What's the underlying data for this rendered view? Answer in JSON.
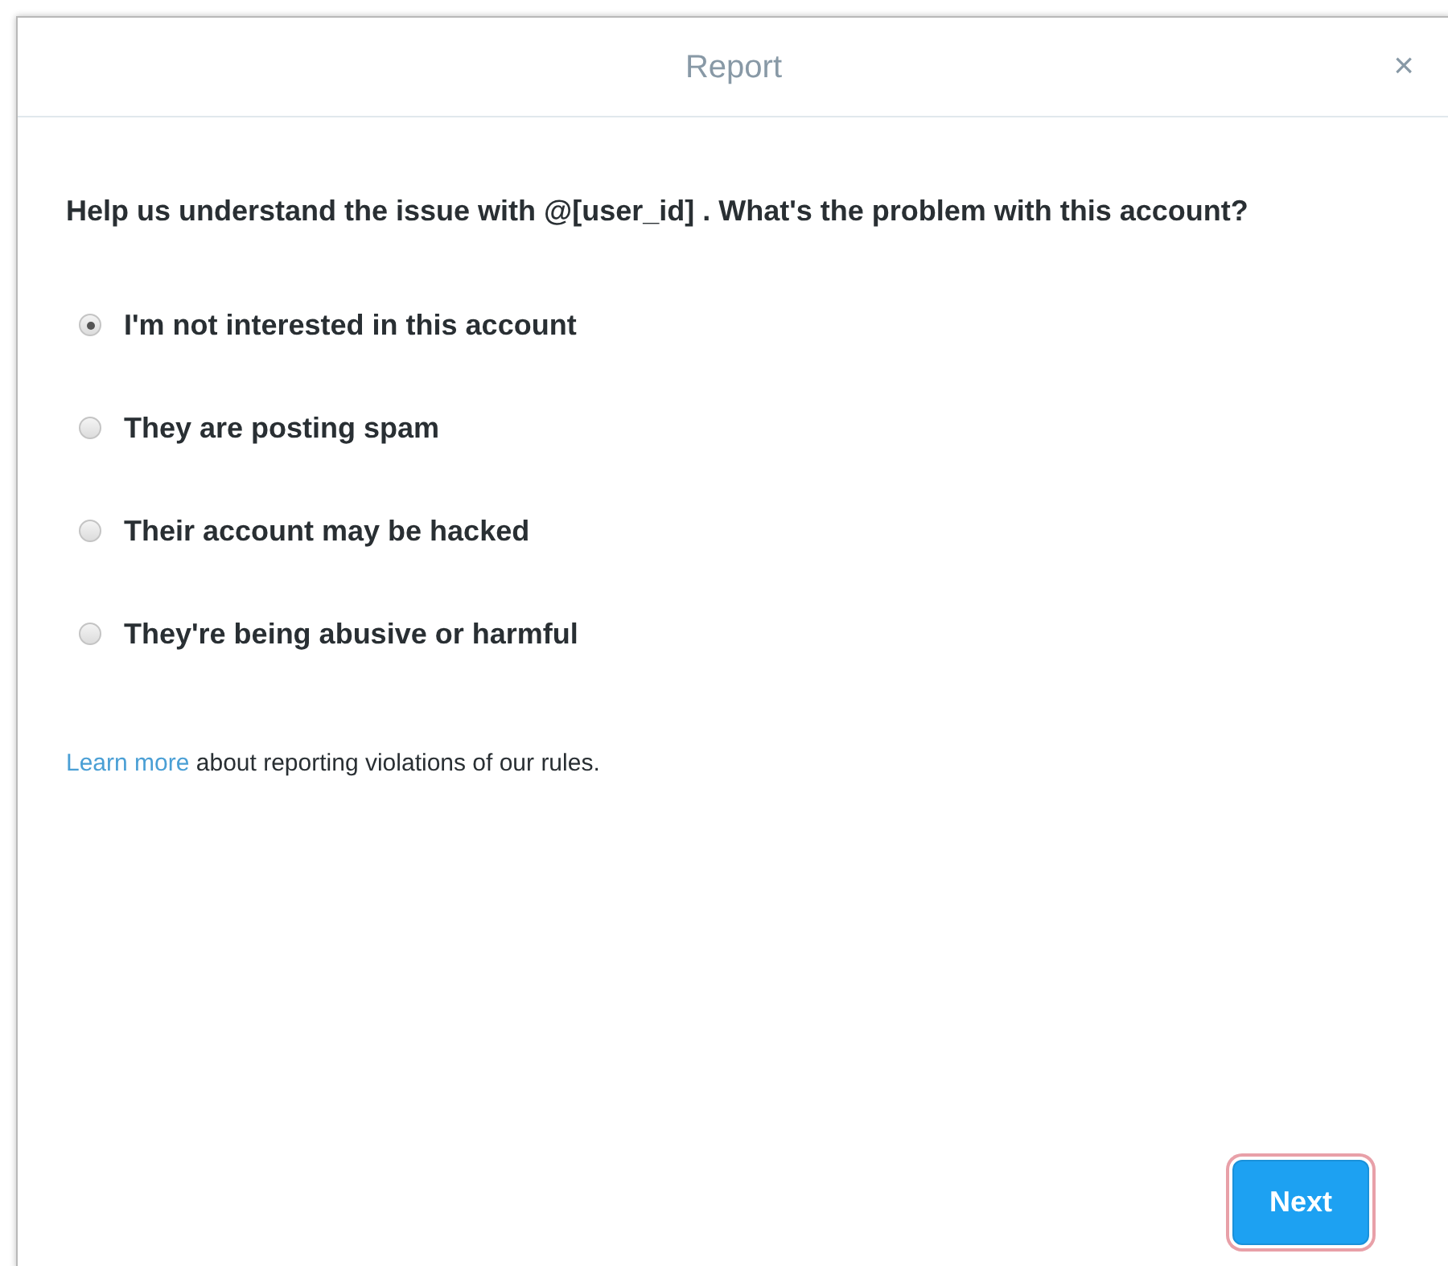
{
  "dialog": {
    "title": "Report",
    "close": "×"
  },
  "question": "Help us understand the issue with @[user_id] . What's the problem with this account?",
  "options": [
    {
      "label": "I'm not interested in this account",
      "selected": true
    },
    {
      "label": "They are posting spam",
      "selected": false
    },
    {
      "label": "Their account may be hacked",
      "selected": false
    },
    {
      "label": "They're being abusive or harmful",
      "selected": false
    }
  ],
  "footer_note": {
    "link": "Learn more",
    "text": "about reporting violations of our rules."
  },
  "next_button": {
    "label": "Next",
    "focused": true
  }
}
